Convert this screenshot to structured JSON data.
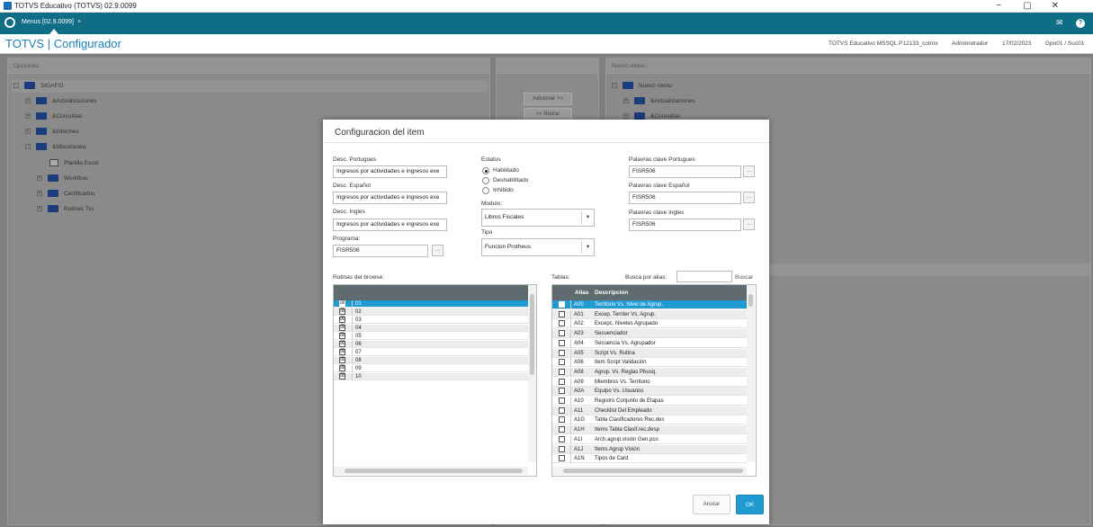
{
  "window": {
    "title": "TOTVS Educativo (TOTVS) 02.9.0099",
    "minimize": "−",
    "maximize": "▢",
    "close": "✕"
  },
  "tabbar": {
    "tab_label": "Menus [02.9.0099]",
    "tab_close": "×",
    "mail_icon": "✉",
    "help_icon": "?"
  },
  "header": {
    "app_title": "TOTVS | Configurador",
    "environment": "TOTVS Educativo MSSQL P12133_cotrox",
    "user": "Administrador",
    "date": "17/02/2023",
    "branch": "Gpo01 / Suc01"
  },
  "background": {
    "options_label": "Opciones:",
    "new_menu_label": "Nuevo menu:",
    "add_button": "Adicionar >>",
    "remove_button": "<< Retirar",
    "tree_root": "SIGAFIS",
    "tree_items": [
      "&Actualizaciones",
      "&Consultas",
      "&Informes",
      "&Miscelanea"
    ],
    "misc_children": [
      "Planilla Excel",
      "Workflow",
      "Certificados",
      "Rutinas Tss"
    ],
    "new_menu_root": "Nuevo menu",
    "new_menu_items": [
      "&Actualizaciones",
      "&Consultas"
    ]
  },
  "dialog": {
    "title": "Configuracion del item",
    "desc_pt_label": "Desc. Portugues",
    "desc_pt_value": "Ingresos por actividades e ingresos exe",
    "desc_es_label": "Desc. Español",
    "desc_es_value": "Ingresos por actividades e ingresos exe",
    "desc_en_label": "Desc. Ingles",
    "desc_en_value": "Ingresos por actividades e ingresos exe",
    "program_label": "Programa:",
    "program_value": "FISR506",
    "status_label": "Estatus",
    "status_options": [
      "Habilitado",
      "Deshabilitado",
      "Inhibido"
    ],
    "status_selected": "Habilitado",
    "module_label": "Modulo:",
    "module_value": "Libros Fiscales",
    "type_label": "Tipo",
    "type_value": "Funcion Protheus",
    "kw_pt_label": "Palavras clave Portugues",
    "kw_pt_value": "FISR506",
    "kw_es_label": "Palavras clave Español",
    "kw_es_value": "FISR506",
    "kw_en_label": "Palavras clave Ingles",
    "kw_en_value": "FISR506",
    "lookup_glyph": "...",
    "combo_arrow": "▼",
    "browse_label": "Rutinas del browse:",
    "browse_rows": [
      "01",
      "02",
      "03",
      "04",
      "05",
      "06",
      "07",
      "08",
      "09",
      "10"
    ],
    "tables_label": "Tablas:",
    "search_alias_label": "Busca por alias:",
    "search_value": "",
    "search_button": "Buscar",
    "tables_headers": [
      "Alias",
      "Descripcion"
    ],
    "tables_rows": [
      {
        "alias": "A00",
        "desc": "Territorio Vs. Nivel de Agrup."
      },
      {
        "alias": "A01",
        "desc": "Excep. Territer Vs. Agrup."
      },
      {
        "alias": "A02",
        "desc": "Excepc. Niveles Agrupado"
      },
      {
        "alias": "A03",
        "desc": "Secuenciador"
      },
      {
        "alias": "A04",
        "desc": "Secuencia Vs. Agrupador"
      },
      {
        "alias": "A05",
        "desc": "Script Vs. Rutina"
      },
      {
        "alias": "A06",
        "desc": "Item Script Validación"
      },
      {
        "alias": "A08",
        "desc": "Agrup. Vs. Reglas Pbusq."
      },
      {
        "alias": "A09",
        "desc": "Miembros Vs. Territorio"
      },
      {
        "alias": "A0A",
        "desc": "Equipo Vs. Usuarios"
      },
      {
        "alias": "A10",
        "desc": "Registro Conjunto de Etapas"
      },
      {
        "alias": "A11",
        "desc": "Checklist Del Empleado"
      },
      {
        "alias": "A1G",
        "desc": "Tabla Clasificadores Rec.des"
      },
      {
        "alias": "A1H",
        "desc": "Items Tabla Clasif.rec.desp"
      },
      {
        "alias": "A1I",
        "desc": "Arch.agrup.visión Gen.pco"
      },
      {
        "alias": "A1J",
        "desc": "Items Agrup Visión"
      },
      {
        "alias": "A1N",
        "desc": "Tipos de Card"
      }
    ],
    "cancel_button": "Anular",
    "ok_button": "OK",
    "check_glyph": "☒"
  },
  "colors": {
    "tabbar": "#0f6d86",
    "title_accent": "#1a82b8",
    "selection": "#1f9bd2",
    "grid_header": "#606b70",
    "ok_button": "#1f9bd2"
  }
}
